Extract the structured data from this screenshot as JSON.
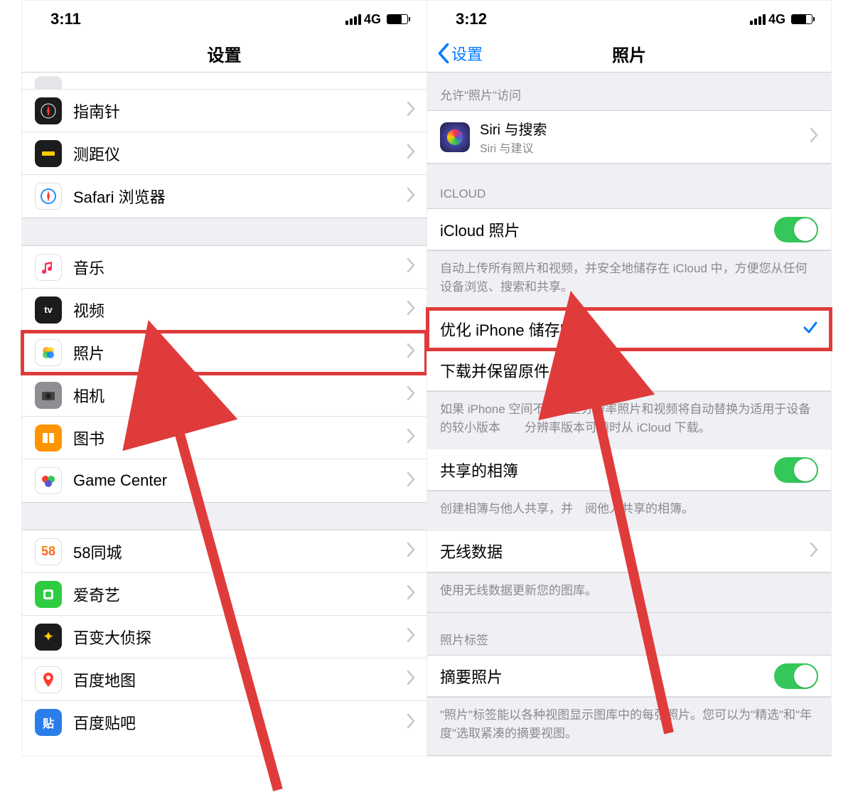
{
  "left": {
    "status": {
      "time": "3:11",
      "net": "4G"
    },
    "title": "设置",
    "rows": [
      {
        "id": "compass",
        "label": "指南针",
        "icon_bg": "#1c1c1e",
        "glyph": "compass"
      },
      {
        "id": "measure",
        "label": "测距仪",
        "icon_bg": "#1c1c1e",
        "glyph": "ruler"
      },
      {
        "id": "safari",
        "label": "Safari 浏览器",
        "icon_bg": "#fff",
        "glyph": "safari"
      }
    ],
    "rows2": [
      {
        "id": "music",
        "label": "音乐",
        "icon_bg": "#fff",
        "glyph": "music"
      },
      {
        "id": "tv",
        "label": "视频",
        "icon_bg": "#1c1c1e",
        "glyph": "tv"
      },
      {
        "id": "photos",
        "label": "照片",
        "icon_bg": "#fff",
        "glyph": "photos",
        "highlight": true
      },
      {
        "id": "camera",
        "label": "相机",
        "icon_bg": "#8e8e93",
        "glyph": "camera"
      },
      {
        "id": "books",
        "label": "图书",
        "icon_bg": "#ff9500",
        "glyph": "book"
      },
      {
        "id": "gamecenter",
        "label": "Game Center",
        "icon_bg": "#fff",
        "glyph": "gc"
      }
    ],
    "rows3": [
      {
        "id": "58",
        "label": "58同城",
        "icon_bg": "#fff",
        "glyph": "58"
      },
      {
        "id": "iqiyi",
        "label": "爱奇艺",
        "icon_bg": "#2ecc40",
        "glyph": "iqiyi"
      },
      {
        "id": "detective",
        "label": "百变大侦探",
        "icon_bg": "#1c1c1e",
        "glyph": "det"
      },
      {
        "id": "bmap",
        "label": "百度地图",
        "icon_bg": "#fff",
        "glyph": "bmap"
      },
      {
        "id": "tieba",
        "label": "百度贴吧",
        "icon_bg": "#2b7de9",
        "glyph": "tieba"
      }
    ]
  },
  "right": {
    "status": {
      "time": "3:12",
      "net": "4G"
    },
    "back": "设置",
    "title": "照片",
    "allow_header": "允许\"照片\"访问",
    "siri": {
      "title": "Siri 与搜索",
      "sub": "Siri 与建议"
    },
    "icloud_header": "ICLOUD",
    "icloud_photos_label": "iCloud 照片",
    "icloud_footer": "自动上传所有照片和视频，并安全地储存在 iCloud 中，方便您从任何设备浏览、搜索和共享。",
    "opt_label": "优化 iPhone 储存空间",
    "download_label": "下载并保留原件",
    "opt_footer_a": "如果 iPhone 空间不",
    "opt_footer_b": "全分辨率照片和视频将自动替换为适用于设备的较小版本",
    "opt_footer_c": "分辨率版本可随时从 iCloud 下载。",
    "shared_label": "共享的相簿",
    "shared_footer": "创建相簿与他人共享，并",
    "shared_footer2": "阅他人共享的相簿。",
    "cellular_label": "无线数据",
    "cellular_footer": "使用无线数据更新您的图库。",
    "tags_header": "照片标签",
    "summary_label": "摘要照片",
    "summary_footer": "\"照片\"标签能以各种视图显示图库中的每张照片。您可以为\"精选\"和\"年度\"选取紧凑的摘要视图。"
  }
}
